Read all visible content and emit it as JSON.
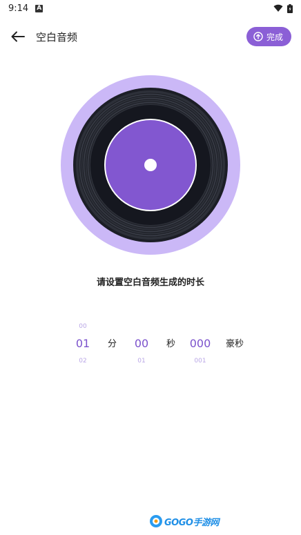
{
  "status_bar": {
    "time": "9:14",
    "notification_glyph": "A"
  },
  "app_bar": {
    "title": "空白音频",
    "done_label": "完成"
  },
  "prompt": "请设置空白音频生成的时长",
  "picker": {
    "minutes": {
      "prev": "00",
      "current": "01",
      "next": "02",
      "unit": "分"
    },
    "seconds": {
      "prev": "",
      "current": "00",
      "next": "01",
      "unit": "秒"
    },
    "milliseconds": {
      "prev": "",
      "current": "000",
      "next": "001",
      "unit": "豪秒"
    }
  },
  "watermark": {
    "text": "GOGO手游网"
  },
  "colors": {
    "accent": "#8b5fd6",
    "picker_text": "#7b52cc",
    "vinyl_outer": "#cbb8f7",
    "vinyl_label": "#8257d0"
  }
}
